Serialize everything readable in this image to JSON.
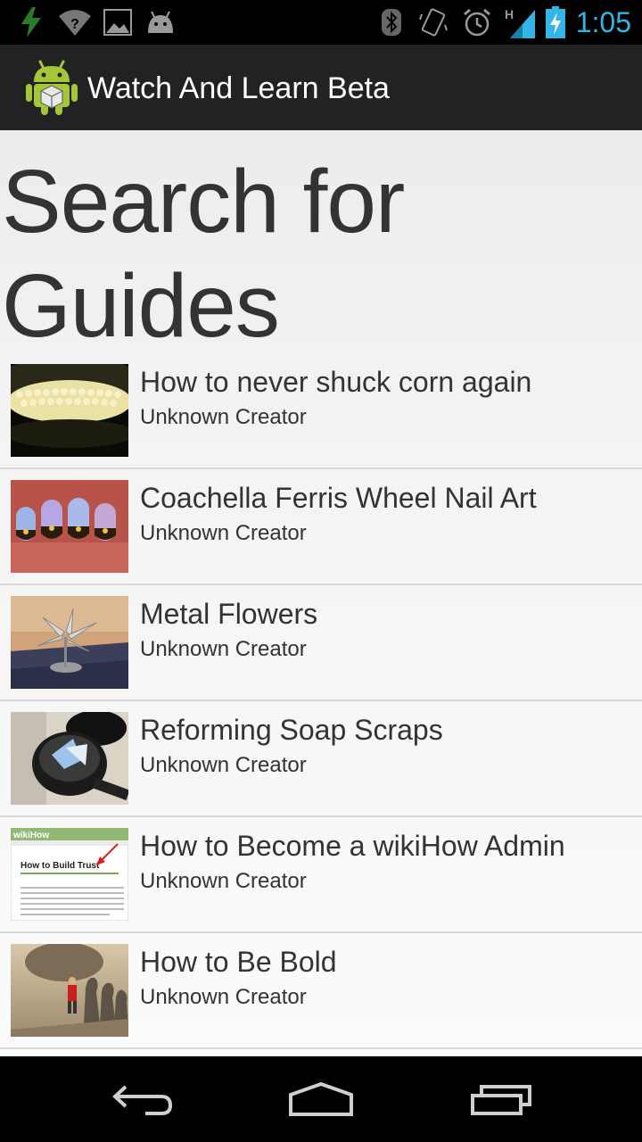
{
  "status_bar": {
    "time": "1:05",
    "network_type": "H",
    "icons": [
      "charging-bolt-icon",
      "wifi-question-icon",
      "gallery-icon",
      "android-debug-icon",
      "bluetooth-icon",
      "vibrate-icon",
      "alarm-icon",
      "signal-icon",
      "battery-charging-icon"
    ],
    "accent_color": "#33b5e5"
  },
  "action_bar": {
    "title": "Watch And Learn Beta",
    "icon": "android-app-icon"
  },
  "main": {
    "heading": "Search for Guides",
    "guides": [
      {
        "title": "How to never shuck corn again",
        "creator": "Unknown Creator",
        "thumbnail": "corn"
      },
      {
        "title": "Coachella Ferris Wheel Nail Art",
        "creator": "Unknown Creator",
        "thumbnail": "nails"
      },
      {
        "title": "Metal Flowers",
        "creator": "Unknown Creator",
        "thumbnail": "flower"
      },
      {
        "title": "Reforming Soap Scraps",
        "creator": "Unknown Creator",
        "thumbnail": "soap"
      },
      {
        "title": "How to Become a wikiHow Admin",
        "creator": "Unknown Creator",
        "thumbnail": "wikihow"
      },
      {
        "title": "How to Be Bold",
        "creator": "Unknown Creator",
        "thumbnail": "chess"
      }
    ],
    "wikihow_thumb": {
      "logo": "wikiHow",
      "heading": "How to Build Trust"
    }
  },
  "nav_bar": {
    "buttons": [
      "back-icon",
      "home-icon",
      "recent-apps-icon"
    ]
  }
}
